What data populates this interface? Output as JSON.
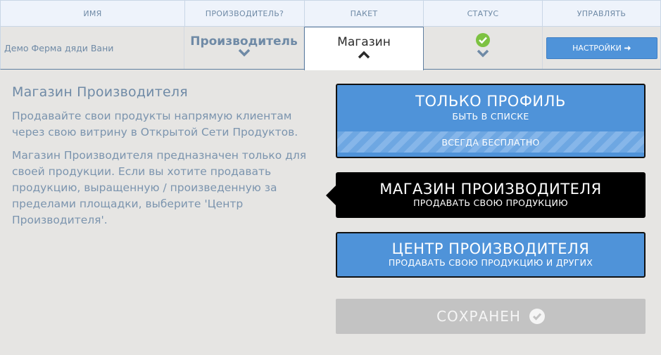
{
  "header": {
    "columns": [
      "ИМЯ",
      "ПРОИЗВОДИТЕЛЬ?",
      "ПАКЕТ",
      "СТАТУС",
      "УПРАВЛЯТЬ"
    ]
  },
  "row": {
    "name": "Демо Ферма дяди Вани",
    "producer": "Производитель",
    "package": "Магазин",
    "settings_button": "НАСТРОЙКИ",
    "status_icon": "check-circle-icon"
  },
  "left_panel": {
    "title": "Магазин Производителя",
    "paragraph1": "Продавайте свои продукты напрямую клиентам через свою витрину в Открытой Сети Продуктов.",
    "paragraph2": "Магазин Производителя предназначен только для своей продукции. Если вы хотите продавать продукцию, выращенную / произведенную за пределами площадки, выберите 'Центр Производителя'."
  },
  "options": [
    {
      "title": "ТОЛЬКО ПРОФИЛЬ",
      "subtitle": "БЫТЬ В СПИСКЕ",
      "badge": "ВСЕГДА БЕСПЛАТНО"
    },
    {
      "title": "МАГАЗИН ПРОИЗВОДИТЕЛЯ",
      "subtitle": "ПРОДАВАТЬ СВОЮ ПРОДУКЦИЮ"
    },
    {
      "title": "ЦЕНТР ПРОИЗВОДИТЕЛЯ",
      "subtitle": "ПРОДАВАТЬ СВОЮ ПРОДУКЦИЮ И ДРУГИХ"
    }
  ],
  "save_button": "СОХРАНЕН",
  "colors": {
    "accent": "#4f93d9",
    "selected": "#000000",
    "status_ok": "#7dc242",
    "saved_bg": "#c3c3c3"
  }
}
